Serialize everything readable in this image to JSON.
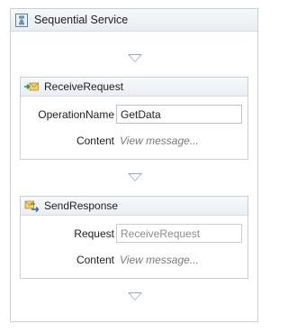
{
  "sequence": {
    "title": "Sequential Service",
    "icon": "sequence-icon"
  },
  "activities": [
    {
      "title": "ReceiveRequest",
      "icon": "receive-envelope-icon",
      "operation_label": "OperationName",
      "operation_value": "GetData",
      "content_label": "Content",
      "content_hint": "View message..."
    },
    {
      "title": "SendResponse",
      "icon": "send-reply-icon",
      "request_label": "Request",
      "request_value": "ReceiveRequest",
      "content_label": "Content",
      "content_hint": "View message..."
    }
  ],
  "colors": {
    "border": "#c9cfd6",
    "header": "#eaeef3",
    "drop_arrow": "#9aa7b5",
    "hint_text": "#7a7a7a"
  }
}
